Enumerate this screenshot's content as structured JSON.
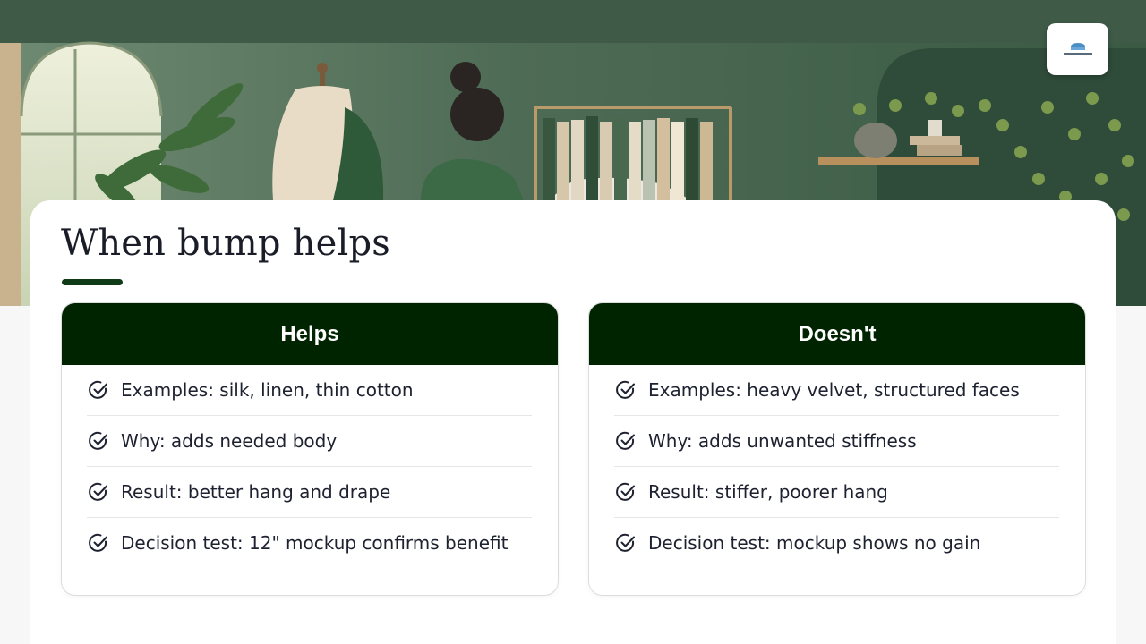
{
  "slide": {
    "title": "When bump helps",
    "accent_color": "#0f3b16",
    "header_color": "#002400"
  },
  "logo": {
    "icon": "logo-icon"
  },
  "panels": [
    {
      "heading": "Helps",
      "items": [
        "Examples: silk, linen, thin cotton",
        "Why: adds needed body",
        "Result: better hang and drape",
        "Decision test: 12\" mockup confirms benefit"
      ]
    },
    {
      "heading": "Doesn't",
      "items": [
        "Examples: heavy velvet, structured faces",
        "Why: adds unwanted stiffness",
        "Result: stiffer, poorer hang",
        "Decision test: mockup shows no gain"
      ]
    }
  ]
}
